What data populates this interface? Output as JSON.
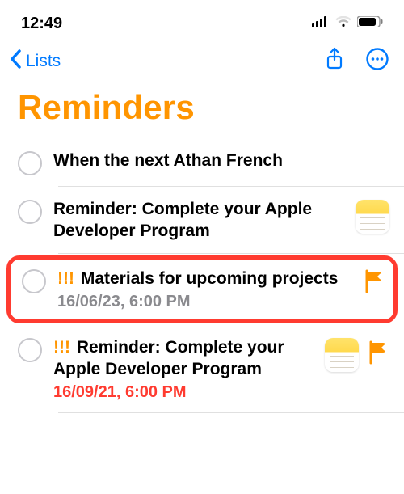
{
  "status": {
    "time": "12:49"
  },
  "nav": {
    "back": "Lists"
  },
  "title": "Reminders",
  "accent": "#ff9500",
  "items": [
    {
      "title": "When the next Athan French",
      "priority": "",
      "meta": "",
      "metaStyle": "",
      "notes": false,
      "flag": false,
      "highlight": false
    },
    {
      "title": "Reminder: Complete your Apple Developer Program",
      "priority": "",
      "meta": "",
      "metaStyle": "",
      "notes": true,
      "flag": false,
      "highlight": false
    },
    {
      "title": "Materials for upcoming projects",
      "priority": "!!!",
      "meta": "16/06/23, 6:00 PM",
      "metaStyle": "gray",
      "notes": false,
      "flag": true,
      "highlight": true
    },
    {
      "title": "Reminder: Complete your Apple Developer Program",
      "priority": "!!!",
      "meta": "16/09/21, 6:00 PM",
      "metaStyle": "red",
      "notes": true,
      "flag": true,
      "highlight": false
    }
  ]
}
